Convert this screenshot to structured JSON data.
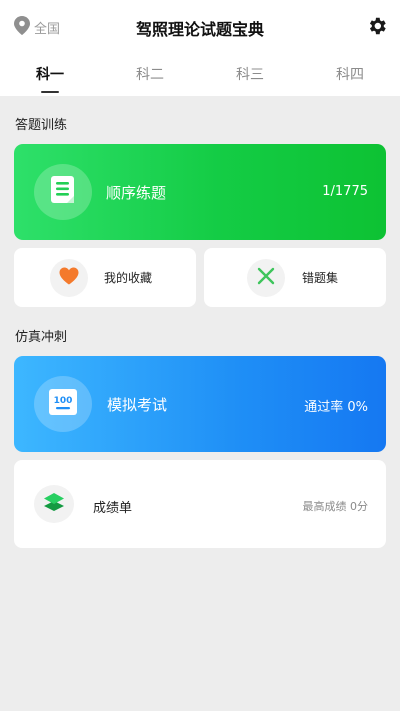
{
  "header": {
    "location_label": "全国",
    "title": "驾照理论试题宝典",
    "location_icon": "location-pin-icon",
    "settings_icon": "gear-icon"
  },
  "tabs": [
    {
      "label": "科一",
      "active": true
    },
    {
      "label": "科二",
      "active": false
    },
    {
      "label": "科三",
      "active": false
    },
    {
      "label": "科四",
      "active": false
    }
  ],
  "sections": {
    "practice_title": "答题训练",
    "sprint_title": "仿真冲刺"
  },
  "practice": {
    "sequential": {
      "label": "顺序练题",
      "progress": "1/1775",
      "icon": "book-icon"
    },
    "favorites": {
      "label": "我的收藏",
      "icon": "heart-icon"
    },
    "mistakes": {
      "label": "错题集",
      "icon": "x-icon"
    }
  },
  "sprint": {
    "mock_exam": {
      "label": "模拟考试",
      "pass_rate": "通过率 0%",
      "icon": "exam-paper-icon",
      "icon_text": "100"
    },
    "report": {
      "label": "成绩单",
      "best_score": "最高成绩 0分",
      "icon": "layers-icon"
    }
  },
  "colors": {
    "green_card": "#14cc45",
    "blue_card": "#1f8ff6",
    "heart": "#f47a2c",
    "x_mark": "#3ec55c",
    "layers": "#1fc45a"
  }
}
